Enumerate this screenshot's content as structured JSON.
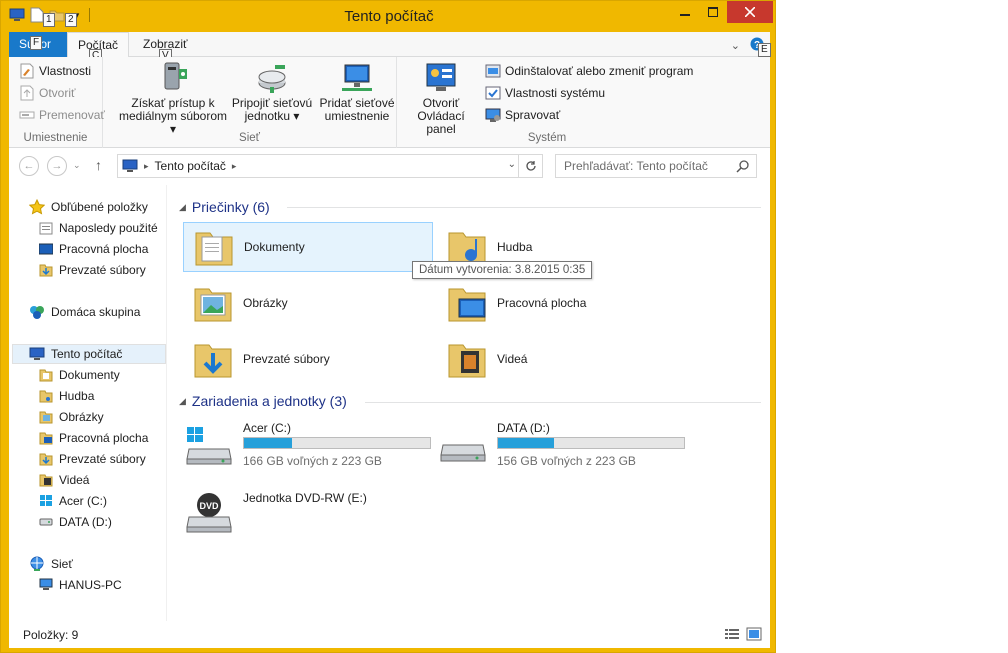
{
  "window": {
    "title": "Tento počítač"
  },
  "keytips": {
    "qat1": "1",
    "qat2": "2",
    "file": "F",
    "computer": "C",
    "view": "V",
    "help": "E"
  },
  "tabs": {
    "file": "Súbor",
    "computer": "Počítač",
    "view": "Zobraziť"
  },
  "ribbon": {
    "location_group": {
      "properties": "Vlastnosti",
      "open": "Otvoriť",
      "rename": "Premenovať",
      "label": "Umiestnenie"
    },
    "network_group": {
      "media_line1": "Získať prístup k",
      "media_line2": "mediálnym súborom",
      "map_line1": "Pripojiť sieťovú",
      "map_line2": "jednotku",
      "add_line1": "Pridať sieťové",
      "add_line2": "umiestnenie",
      "label": "Sieť"
    },
    "system_group": {
      "cpanel_line1": "Otvoriť",
      "cpanel_line2": "Ovládací panel",
      "uninstall": "Odinštalovať alebo zmeniť program",
      "sysprops": "Vlastnosti systému",
      "manage": "Spravovať",
      "label": "Systém"
    }
  },
  "address": {
    "segment": "Tento počítač"
  },
  "search": {
    "placeholder": "Prehľadávať: Tento počítač"
  },
  "navpane": {
    "favorites": "Obľúbené položky",
    "recent": "Naposledy použité",
    "desktop": "Pracovná plocha",
    "downloads": "Prevzaté súbory",
    "homegroup": "Domáca skupina",
    "thispc": "Tento počítač",
    "pc_documents": "Dokumenty",
    "pc_music": "Hudba",
    "pc_pictures": "Obrázky",
    "pc_desktop": "Pracovná plocha",
    "pc_downloads": "Prevzaté súbory",
    "pc_videos": "Videá",
    "pc_c": "Acer (C:)",
    "pc_d": "DATA (D:)",
    "network": "Sieť",
    "hanus": "HANUS-PC"
  },
  "folders": {
    "header": "Priečinky (6)",
    "items": [
      "Dokumenty",
      "Hudba",
      "Obrázky",
      "Pracovná plocha",
      "Prevzaté súbory",
      "Videá"
    ]
  },
  "devices": {
    "header": "Zariadenia a jednotky (3)",
    "c_name": "Acer (C:)",
    "c_free": "166 GB voľných z 223 GB",
    "c_used_fraction": 0.256,
    "d_name": "DATA (D:)",
    "d_free": "156 GB voľných z 223 GB",
    "d_used_fraction": 0.3,
    "dvd_name": "Jednotka DVD-RW (E:)",
    "dvd_label": "DVD"
  },
  "tooltip": {
    "text": "Dátum vytvorenia: 3.8.2015 0:35"
  },
  "status": {
    "items": "Položky: 9"
  },
  "colors": {
    "accent": "#f0b800",
    "file_tab": "#1979ca",
    "header": "#1e3287",
    "bar": "#26a0da"
  }
}
